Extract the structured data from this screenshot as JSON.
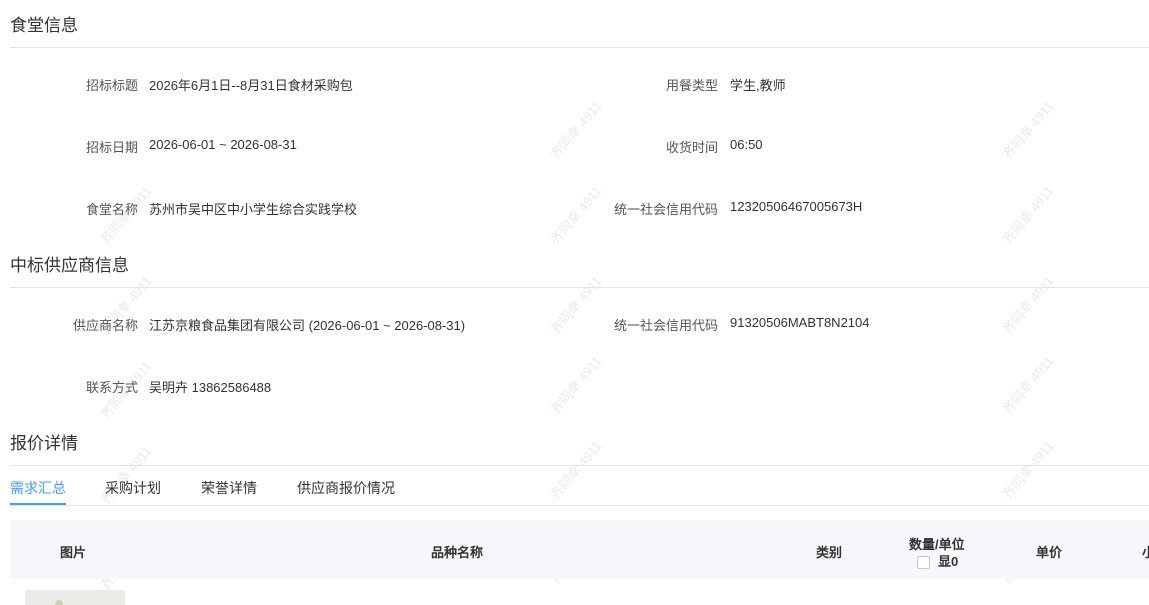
{
  "canteen_section": {
    "title": "食堂信息",
    "tender_title_label": "招标标题",
    "tender_title_value": "2026年6月1日--8月31日食材采购包",
    "meal_type_label": "用餐类型",
    "meal_type_value": "学生,教师",
    "tender_date_label": "招标日期",
    "tender_date_value": "2026-06-01 ~ 2026-08-31",
    "receive_time_label": "收货时间",
    "receive_time_value": "06:50",
    "canteen_name_label": "食堂名称",
    "canteen_name_value": "苏州市吴中区中小学生综合实践学校",
    "credit_code_label": "统一社会信用代码",
    "credit_code_value": "12320506467005673H"
  },
  "supplier_section": {
    "title": "中标供应商信息",
    "supplier_name_label": "供应商名称",
    "supplier_name_value": "江苏京粮食品集团有限公司 (2026-06-01 ~ 2026-08-31)",
    "credit_code_label": "统一社会信用代码",
    "credit_code_value": "91320506MABT8N2104",
    "contact_label": "联系方式",
    "contact_value": "吴明卉 13862586488"
  },
  "quote_section": {
    "title": "报价详情",
    "tabs": [
      "需求汇总",
      "采购计划",
      "荣誉详情",
      "供应商报价情况"
    ],
    "active_tab": 0
  },
  "table": {
    "headers": {
      "image": "图片",
      "variety_name": "品种名称",
      "category": "类别",
      "quantity_unit": "数量/单位",
      "quantity_toggle": "显0",
      "unit_price": "单价",
      "subtotal_partial": "小"
    }
  },
  "watermark_text": "齐同幸 4911",
  "colors": {
    "accent": "#409eff",
    "divider": "#e4e4e4",
    "table_header_bg": "#f5f7fa"
  }
}
